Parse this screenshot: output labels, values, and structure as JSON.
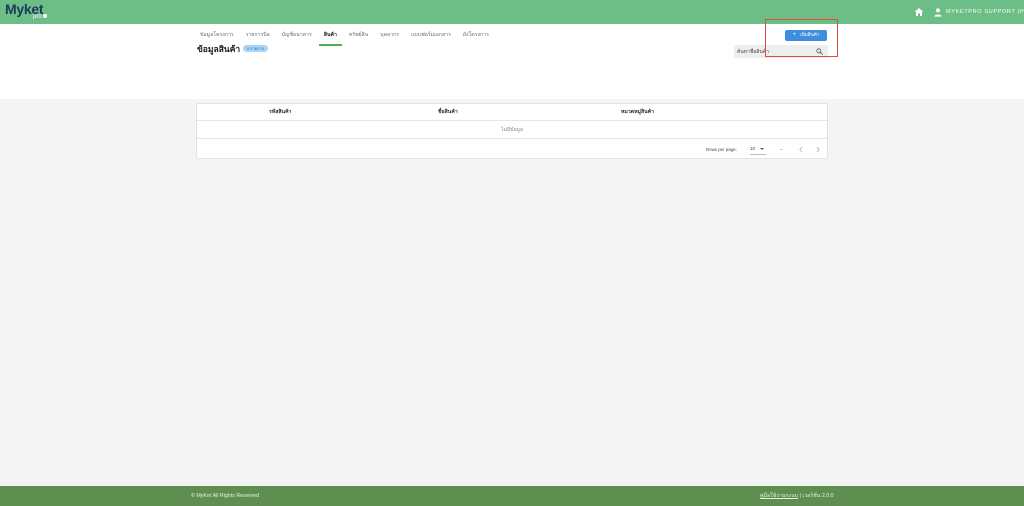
{
  "app": {
    "logo_text": "Myket",
    "logo_sub": "pro"
  },
  "topbar": {
    "home_icon": "home-icon",
    "user_icon": "user-icon",
    "user_name": "MYKETPRO SUPPORT (P)"
  },
  "tabs": [
    {
      "label": "ข้อมูลโครงการ",
      "active": false
    },
    {
      "label": "รายการบิล",
      "active": false
    },
    {
      "label": "บัญชีธนาคาร",
      "active": false
    },
    {
      "label": "สินค้า",
      "active": true
    },
    {
      "label": "ทรัพย์สิน",
      "active": false
    },
    {
      "label": "บุคลากร",
      "active": false
    },
    {
      "label": "แบบฟอร์มเอกสาร",
      "active": false
    },
    {
      "label": "ผังโครงการ",
      "active": false
    }
  ],
  "page": {
    "title": "ข้อมูลสินค้า",
    "count_badge": "0 รายการ",
    "add_button_label": "เพิ่มสินค้า",
    "search_placeholder": "ค้นหาชื่อสินค้า"
  },
  "table": {
    "columns": [
      "รหัสสินค้า",
      "ชื่อสินค้า",
      "หมวดหมู่สินค้า"
    ],
    "empty_text": "ไม่มีข้อมูล",
    "rows_per_page_label": "Rows per page:",
    "rows_per_page_value": "10",
    "range_text": "–"
  },
  "footer": {
    "copyright": "© MyKet All Rights Reserved",
    "manual_link": "คู่มือใช้งานระบบ",
    "version": "| เวอร์ชั่น 2.0.0"
  },
  "colors": {
    "topbar": "#6cbd86",
    "bottombar": "#5f8f50",
    "accent": "#3d8fde",
    "active_tab_underline": "#4caf50",
    "highlight": "#e04b3c"
  }
}
